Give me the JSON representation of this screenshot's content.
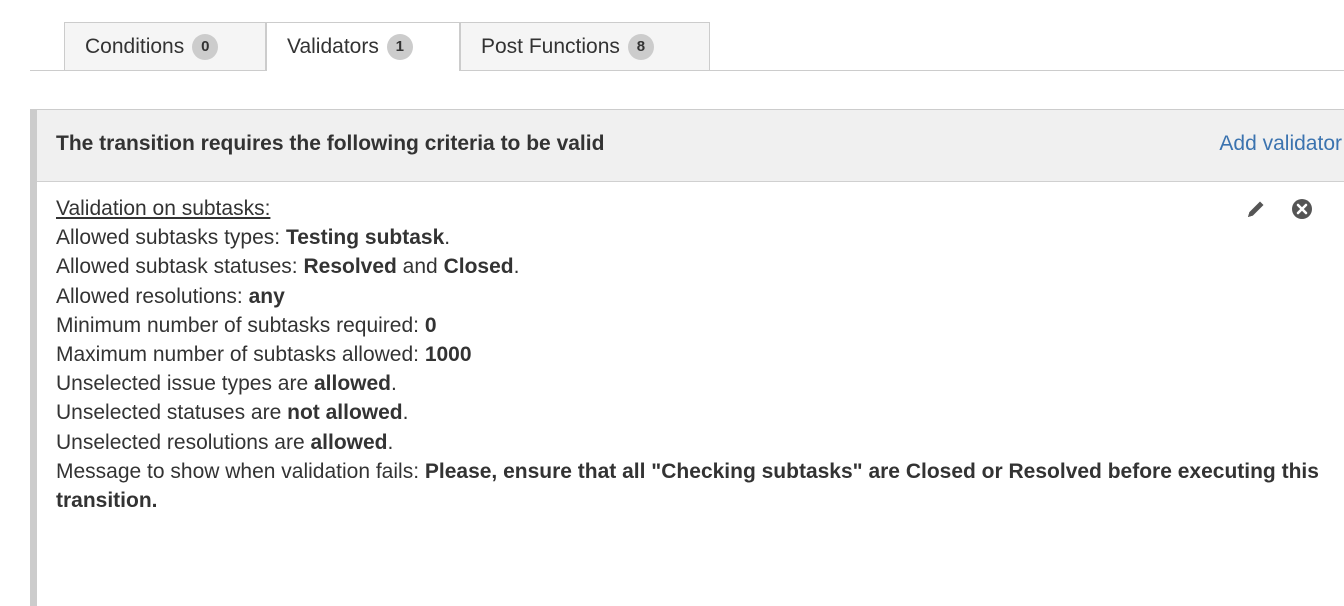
{
  "tabs": [
    {
      "label": "Conditions",
      "count": "0",
      "active": false
    },
    {
      "label": "Validators",
      "count": "1",
      "active": true
    },
    {
      "label": "Post Functions",
      "count": "8",
      "active": false
    }
  ],
  "panel": {
    "title": "The transition requires the following criteria to be valid",
    "add_link": "Add validator",
    "accent_color": "#3b73af"
  },
  "validator": {
    "heading": "Validation on subtasks:",
    "lines": [
      {
        "label": "Allowed subtasks types: ",
        "value": "Testing subtask",
        "suffix": "."
      },
      {
        "label": "Allowed subtask statuses: ",
        "value": "Resolved",
        "mid": " and ",
        "value2": "Closed",
        "suffix": "."
      },
      {
        "label": "Allowed resolutions: ",
        "value": "any",
        "suffix": ""
      },
      {
        "label": "Minimum number of subtasks required: ",
        "value": "0",
        "suffix": ""
      },
      {
        "label": "Maximum number of subtasks allowed: ",
        "value": "1000",
        "suffix": ""
      },
      {
        "label": "Unselected issue types are ",
        "value": "allowed",
        "suffix": "."
      },
      {
        "label": "Unselected statuses are ",
        "value": "not allowed",
        "suffix": "."
      },
      {
        "label": "Unselected resolutions are ",
        "value": "allowed",
        "suffix": "."
      }
    ],
    "message": {
      "label": "Message to show when validation fails: ",
      "value": "Please, ensure that all \"Checking subtasks\" are Closed or Resolved before executing this transition."
    },
    "icons": {
      "edit": "pencil-icon",
      "delete": "close-circle-icon"
    }
  }
}
